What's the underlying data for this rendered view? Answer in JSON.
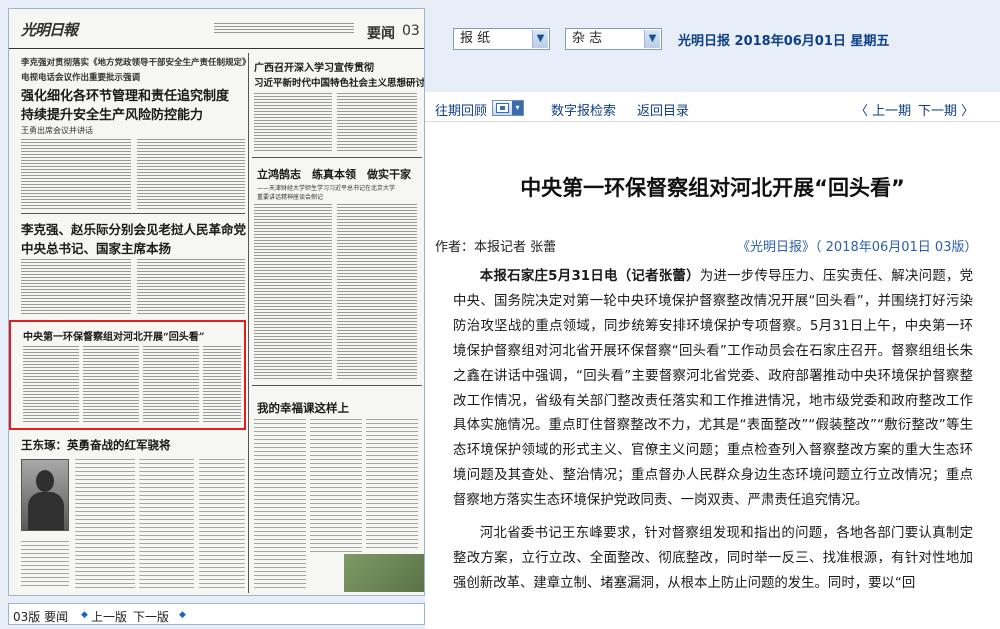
{
  "paper_page": {
    "logo": "光明日報",
    "page_name": "要闻",
    "page_number": "03",
    "left_headlines": [
      "李克强对贯彻落实《地方党政领导干部安全生产责任制规定》",
      "电视电话会议作出重要批示强调",
      "强化细化各环节管理和责任追究制度",
      "持续提升安全生产风险防控能力",
      "王勇出席会议并讲话",
      "李克强、赵乐际分别会见老挝人民革命党",
      "中央总书记、国家主席本扬",
      "中央第一环保督察组对河北开展“回头看”",
      "王东琢：英勇奋战的红军骁将"
    ],
    "right_headlines": [
      "广西召开深入学习宣传贯彻",
      "习近平新时代中国特色社会主义思想研讨会",
      "立鸿鹄志　练真本领　做实干家",
      "——天津财经大学师生学习习近平总书记在北京大学",
      "重要讲话精神座谈会侧记",
      "我的幸福课这样上"
    ]
  },
  "page_nav": {
    "current": "03版 要闻",
    "prev": "上一版",
    "next": "下一版"
  },
  "selectors": {
    "paper": "报 纸",
    "magazine": "杂 志"
  },
  "date_line": "光明日报  2018年06月01日  星期五",
  "toolbar": {
    "past_issues": "往期回顾",
    "search": "数字报检索",
    "back_to_index": "返回目录",
    "prev_issue": "〈 上一期",
    "next_issue": "下一期 〉"
  },
  "article": {
    "title": "中央第一环保督察组对河北开展“回头看”",
    "byline": "作者：本报记者 张蕾",
    "source": "《光明日报》（ 2018年06月01日 03版）",
    "lead": "本报石家庄5月31日电（记者张蕾）",
    "p1": "为进一步传导压力、压实责任、解决问题，党中央、国务院决定对第一轮中央环境保护督察整改情况开展“回头看”，并围绕打好污染防治攻坚战的重点领域，同步统筹安排环境保护专项督察。5月31日上午，中央第一环境保护督察组对河北省开展环保督察“回头看”工作动员会在石家庄召开。督察组组长朱之鑫在讲话中强调，“回头看”主要督察河北省党委、政府部署推动中央环境保护督察整改工作情况，省级有关部门整改责任落实和工作推进情况，地市级党委和政府整改工作具体实施情况。重点盯住督察整改不力，尤其是“表面整改”“假装整改”“敷衍整改”等生态环境保护领域的形式主义、官僚主义问题；重点检查列入督察整改方案的重大生态环境问题及其查处、整治情况；重点督办人民群众身边生态环境问题立行立改情况；重点督察地方落实生态环境保护党政同责、一岗双责、严肃责任追究情况。",
    "p2": "河北省委书记王东峰要求，针对督察组发现和指出的问题，各地各部门要认真制定整改方案，立行立改、全面整改、彻底整改，同时举一反三、找准根源，有针对性地加强创新改革、建章立制、堵塞漏洞，从根本上防止问题的发生。同时，要以“回"
  }
}
